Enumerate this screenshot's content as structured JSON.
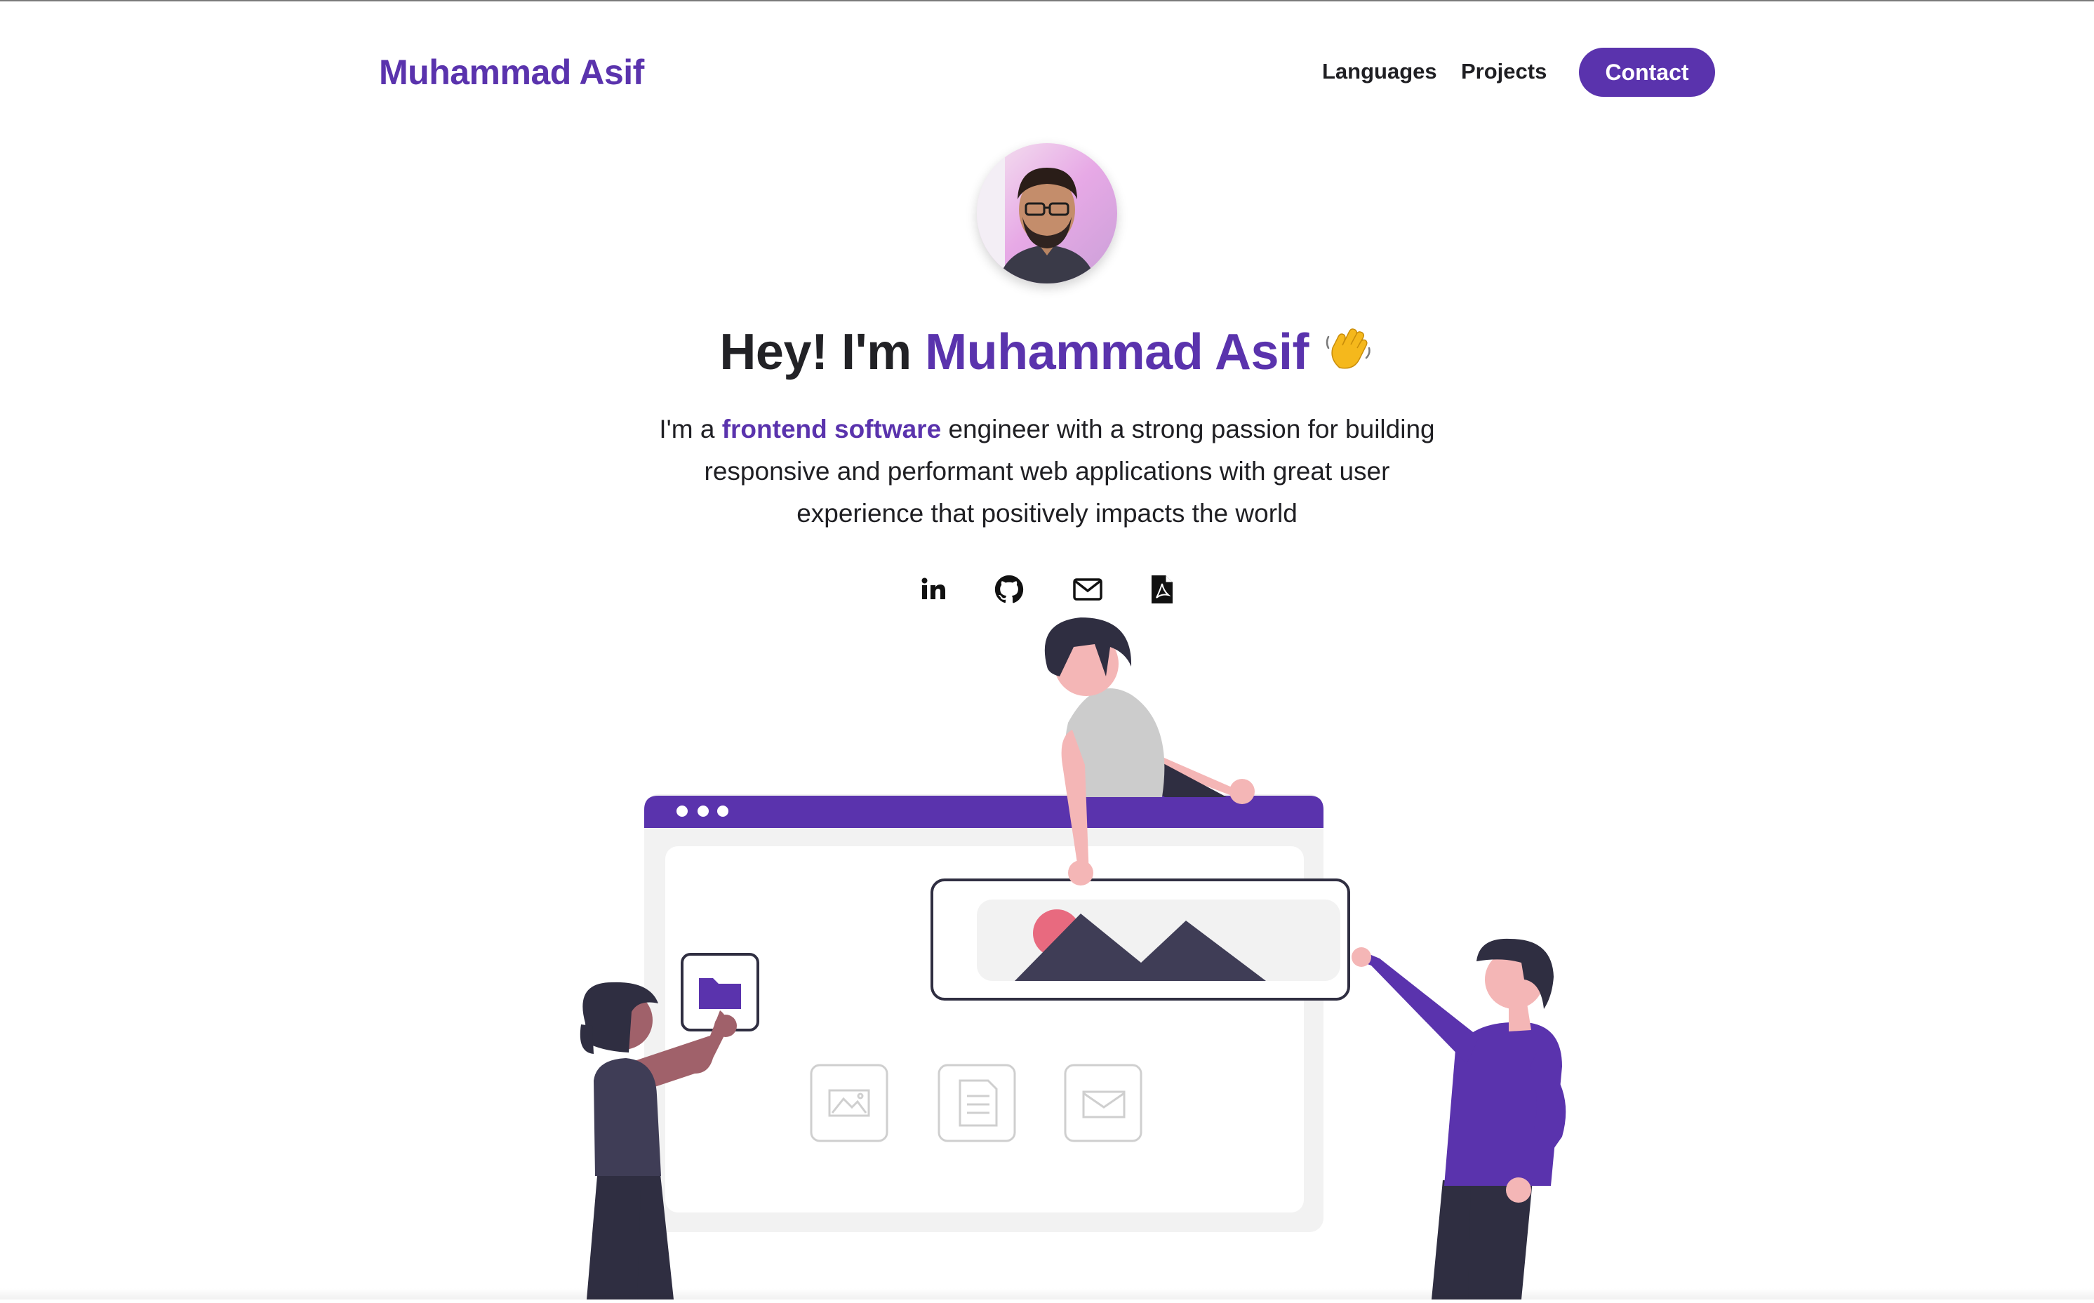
{
  "nav": {
    "brand": "Muhammad Asif",
    "links": [
      {
        "label": "Languages"
      },
      {
        "label": "Projects"
      }
    ],
    "contact_label": "Contact"
  },
  "hero": {
    "greeting_prefix": "Hey! I'm ",
    "greeting_name": "Muhammad Asif",
    "greeting_emoji": "wave-hand",
    "bio_prefix": "I'm a ",
    "bio_highlight": "frontend software",
    "bio_line1_rest": " engineer with a strong passion for building",
    "bio_line2": "responsive and performant web applications with great user",
    "bio_line3": "experience that positively impacts the world"
  },
  "socials": [
    {
      "icon": "linkedin-icon"
    },
    {
      "icon": "github-icon"
    },
    {
      "icon": "mail-icon"
    },
    {
      "icon": "pdf-icon"
    }
  ],
  "colors": {
    "accent": "#5a33ad",
    "text": "#1f1f23",
    "window_bg": "#f2f2f2",
    "figure_dark": "#2f2e41",
    "skin_light": "#f4b6b6",
    "skin_dark": "#a0616a",
    "shirt_grey": "#cccccc",
    "sun": "#e86a7f"
  }
}
